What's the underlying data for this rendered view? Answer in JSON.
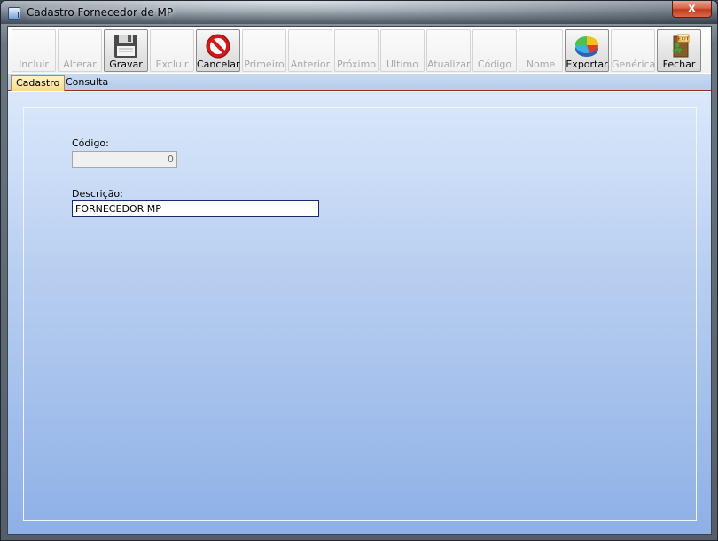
{
  "window": {
    "title": "Cadastro Fornecedor de MP",
    "close_label": "x"
  },
  "toolbar": {
    "buttons": [
      {
        "label": "Incluir",
        "enabled": false
      },
      {
        "label": "Alterar",
        "enabled": false
      },
      {
        "label": "Gravar",
        "enabled": true,
        "icon": "floppy-disk-icon"
      },
      {
        "label": "Excluir",
        "enabled": false
      },
      {
        "label": "Cancelar",
        "enabled": true,
        "icon": "cancel-icon"
      },
      {
        "label": "Primeiro",
        "enabled": false
      },
      {
        "label": "Anterior",
        "enabled": false
      },
      {
        "label": "Próximo",
        "enabled": false
      },
      {
        "label": "Último",
        "enabled": false
      },
      {
        "label": "Atualizar",
        "enabled": false
      },
      {
        "label": "Código",
        "enabled": false
      },
      {
        "label": "Nome",
        "enabled": false
      },
      {
        "label": "Exportar",
        "enabled": true,
        "icon": "pie-chart-icon"
      },
      {
        "label": "Genérica",
        "enabled": false
      },
      {
        "label": "Fechar",
        "enabled": true,
        "icon": "exit-door-icon"
      }
    ]
  },
  "tabs": [
    {
      "label": "Cadastro",
      "active": true
    },
    {
      "label": "Consulta",
      "active": false
    }
  ],
  "form": {
    "codigo": {
      "label": "Código:",
      "value": "0"
    },
    "descricao": {
      "label": "Descrição:",
      "value": "FORNECEDOR MP"
    }
  },
  "colors": {
    "accent_tab": "#ffd98a",
    "panel_top": "#dbe8fb",
    "panel_bottom": "#8eb0e6",
    "tab_underline": "#9e2a2a"
  }
}
